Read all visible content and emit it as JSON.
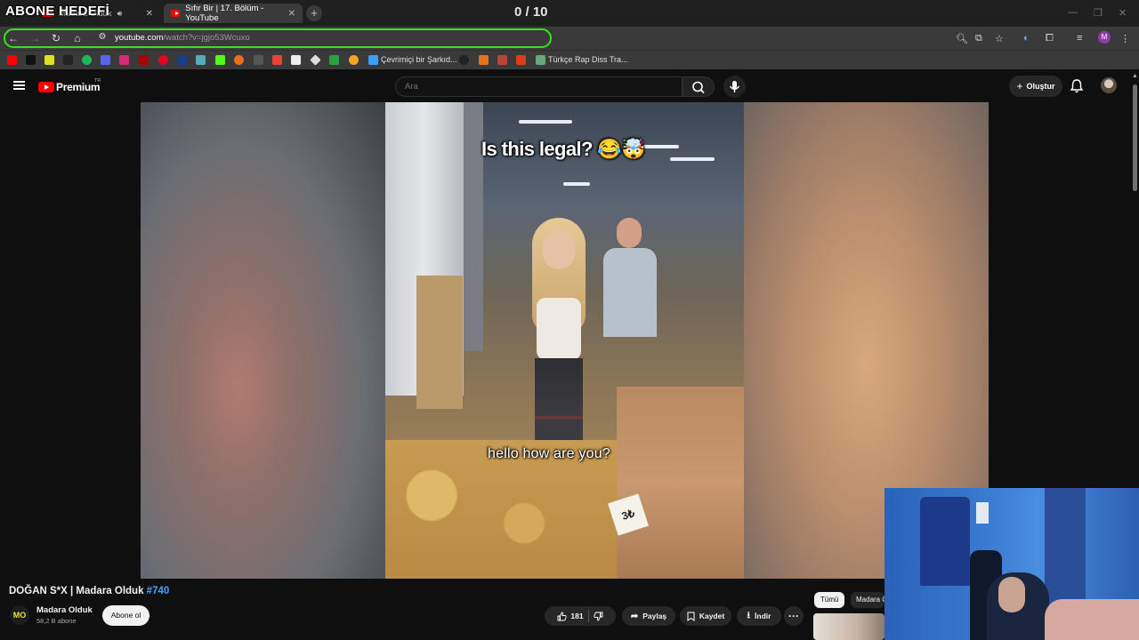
{
  "overlay": {
    "goal_label": "ABONE HEDEFİ",
    "counter": "0 / 10"
  },
  "browser": {
    "tabs": [
      {
        "label": "Madara Olduk",
        "active": false,
        "muted_icon": "speaker-icon"
      },
      {
        "label": "Sıfır Bir | 17. Bölüm - YouTube",
        "active": true
      }
    ],
    "url_host": "youtube.com",
    "url_path": "/watch?v=jgjo53Wcuxo",
    "bookmarks": [
      {
        "label": "Çevrimiçi bir Şarkıd..."
      },
      {
        "label": "Türkçe Rap Diss Tra..."
      }
    ],
    "colors": {
      "omnibox_highlight": "#33e61a",
      "tab_bg": "#3a3a3a"
    }
  },
  "youtube": {
    "brand": "Premium",
    "region": "TR",
    "search_placeholder": "Ara",
    "create_label": "Oluştur",
    "player": {
      "caption_top": "Is this legal? 😂🤯",
      "caption_bottom": "hello how are you?",
      "price_sign": "3₺"
    },
    "video": {
      "title": "DOĞAN S*X | Madara Olduk ",
      "title_tag": "#740",
      "channel_logo_text": "MO",
      "channel_name": "Madara Olduk",
      "subscribers": "58,2 B abone",
      "subscribe_label": "Abone ol",
      "like_count": "181",
      "share_label": "Paylaş",
      "save_label": "Kaydet",
      "download_label": "İndir",
      "more_label": "···"
    },
    "chips": {
      "all": "Tümü",
      "channel": "Madara Olduk"
    },
    "colors": {
      "brand_red": "#ff0000",
      "hashtag_blue": "#3ea6ff",
      "bg": "#0f0f0f"
    }
  }
}
